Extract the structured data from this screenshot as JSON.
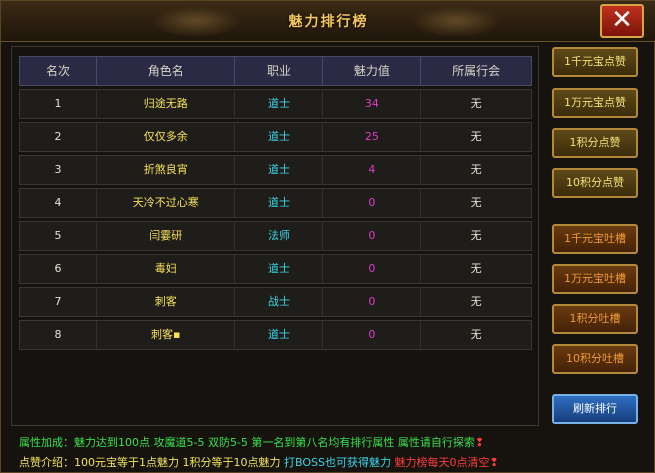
{
  "window": {
    "title": "魅力排行榜"
  },
  "table": {
    "headers": [
      "名次",
      "角色名",
      "职业",
      "魅力值",
      "所属行会"
    ],
    "rows": [
      {
        "rank": "1",
        "name": "归途无路",
        "job": "道士",
        "charm": "34",
        "guild": "无"
      },
      {
        "rank": "2",
        "name": "仅仅多余",
        "job": "道士",
        "charm": "25",
        "guild": "无"
      },
      {
        "rank": "3",
        "name": "折煞良宵",
        "job": "道士",
        "charm": "4",
        "guild": "无"
      },
      {
        "rank": "4",
        "name": "天冷不过心寒",
        "job": "道士",
        "charm": "0",
        "guild": "无"
      },
      {
        "rank": "5",
        "name": "闫霎研",
        "job": "法师",
        "charm": "0",
        "guild": "无"
      },
      {
        "rank": "6",
        "name": "毒妇",
        "job": "道士",
        "charm": "0",
        "guild": "无"
      },
      {
        "rank": "7",
        "name": "刺客",
        "job": "战士",
        "charm": "0",
        "guild": "无"
      },
      {
        "rank": "8",
        "name": "刺客▪",
        "job": "道士",
        "charm": "0",
        "guild": "无"
      }
    ]
  },
  "buttons": {
    "like": [
      "1千元宝点赞",
      "1万元宝点赞",
      "1积分点赞",
      "10积分点赞"
    ],
    "boo": [
      "1千元宝吐槽",
      "1万元宝吐槽",
      "1积分吐槽",
      "10积分吐槽"
    ],
    "refresh": "刷新排行"
  },
  "footer": {
    "line1_a": "属性加成：魅力达到100点 攻魔道5-5 双防5-5 第一名到第八名均有排行属性 属性请自行探索",
    "line1_b": "❢",
    "line2_a": "点赞介绍：100元宝等于1点魅力 1积分等于10点魅力 ",
    "line2_b": "打BOSS也可获得魅力",
    "line2_c": " 魅力榜每天0点清空",
    "line2_d": "❢"
  },
  "icons": {
    "close": "close-icon"
  },
  "colors": {
    "name": "#f7e25a",
    "job": "#39d6e8",
    "charm": "#e03cc8",
    "refresh": "#2f6fc0"
  }
}
